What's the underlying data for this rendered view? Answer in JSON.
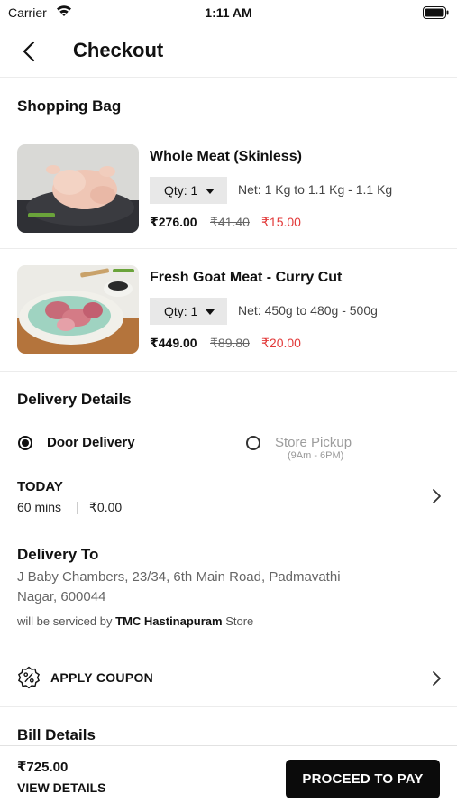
{
  "status_bar": {
    "carrier": "Carrier",
    "time": "1:11 AM"
  },
  "nav": {
    "title": "Checkout"
  },
  "bag": {
    "title": "Shopping Bag",
    "items": [
      {
        "name": "Whole Meat (Skinless)",
        "qty": "Qty: 1",
        "net": "Net: 1 Kg to 1.1 Kg - 1.1 Kg",
        "price": "₹276.00",
        "mrp": "₹41.40",
        "discount": "₹15.00"
      },
      {
        "name": "Fresh Goat Meat - Curry Cut",
        "qty": "Qty: 1",
        "net": "Net: 450g to 480g - 500g",
        "price": "₹449.00",
        "mrp": "₹89.80",
        "discount": "₹20.00"
      }
    ]
  },
  "delivery": {
    "title": "Delivery Details",
    "door_label": "Door Delivery",
    "pickup_label": "Store Pickup",
    "pickup_hours": "(9Am - 6PM)",
    "slot_day": "TODAY",
    "slot_time": "60 mins",
    "slot_fee": "₹0.00",
    "to_title": "Delivery To",
    "address_line1": "J Baby Chambers, 23/34, 6th Main Road, Padmavathi",
    "address_line2": "Nagar, 600044",
    "serviced_prefix": "will be serviced by",
    "store_name": "TMC Hastinapuram",
    "serviced_suffix": "Store"
  },
  "coupon": {
    "label": "APPLY COUPON"
  },
  "bill": {
    "title": "Bill Details"
  },
  "footer": {
    "total": "₹725.00",
    "view_details": "VIEW DETAILS",
    "pay_label": "PROCEED TO PAY"
  }
}
